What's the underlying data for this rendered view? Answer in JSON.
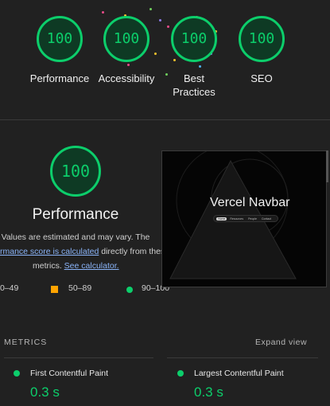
{
  "categories": [
    {
      "label": "Performance",
      "score": "100"
    },
    {
      "label": "Accessibility",
      "score": "100"
    },
    {
      "label": "Best Practices",
      "label_line1": "Best",
      "label_line2": "Practices",
      "score": "100"
    },
    {
      "label": "SEO",
      "score": "100"
    }
  ],
  "performance": {
    "score": "100",
    "title": "Performance",
    "note_line1": "Values are estimated and may vary. The",
    "note_link1": "rmance score is calculated",
    "note_line2_rest": " directly from thes",
    "note_line3_prefix": "metrics.",
    "note_link2": "See calculator."
  },
  "legend": {
    "poor": "0–49",
    "average": "50–89",
    "good": "90–100"
  },
  "screenshot": {
    "title": "Vercel Navbar",
    "nav_items": [
      "Home",
      "Resources",
      "People",
      "Contact"
    ]
  },
  "metrics": {
    "heading": "METRICS",
    "expand": "Expand view",
    "items": [
      {
        "name": "First Contentful Paint",
        "value": "0.3 s"
      },
      {
        "name": "Largest Contentful Paint",
        "value": "0.3 s"
      }
    ]
  },
  "colors": {
    "good": "#0cce6b",
    "average": "#ffa400",
    "background": "#212121"
  }
}
